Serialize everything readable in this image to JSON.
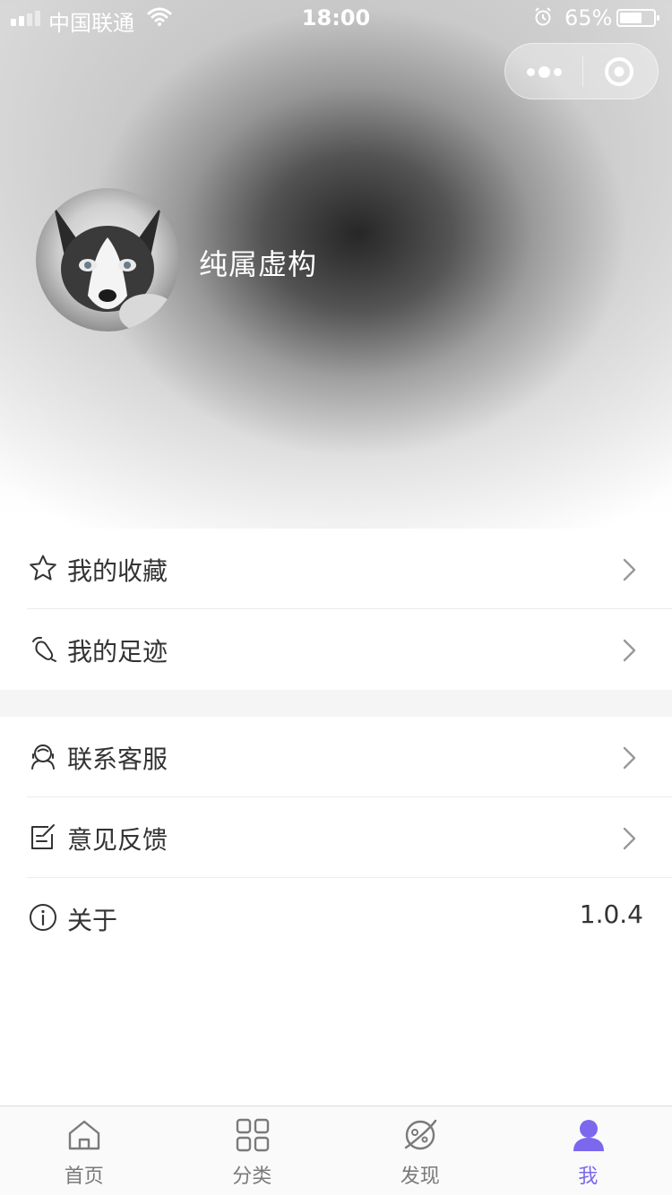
{
  "status_bar": {
    "carrier": "中国联通",
    "time": "18:00",
    "battery": "65%"
  },
  "profile": {
    "username": "纯属虚构"
  },
  "menu": {
    "group1": [
      {
        "label": "我的收藏",
        "icon": "star-icon"
      },
      {
        "label": "我的足迹",
        "icon": "footprint-icon"
      }
    ],
    "group2": [
      {
        "label": "联系客服",
        "icon": "customer-service-icon"
      },
      {
        "label": "意见反馈",
        "icon": "feedback-icon"
      },
      {
        "label": "关于",
        "icon": "info-icon",
        "value": "1.0.4"
      }
    ]
  },
  "tabbar": {
    "items": [
      {
        "label": "首页",
        "icon": "home-icon"
      },
      {
        "label": "分类",
        "icon": "grid-icon"
      },
      {
        "label": "发现",
        "icon": "planet-icon"
      },
      {
        "label": "我",
        "icon": "user-icon"
      }
    ],
    "active_index": 3
  },
  "colors": {
    "accent": "#7b68ee",
    "tab_inactive": "#7a7a7a"
  }
}
